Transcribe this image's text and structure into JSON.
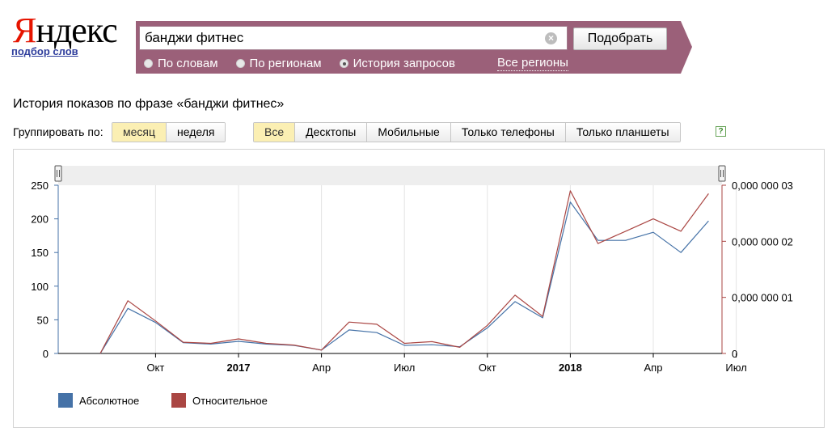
{
  "logo": {
    "first_letter": "Я",
    "rest": "ндекс",
    "sub_link": "подбор слов"
  },
  "search": {
    "value": "банджи фитнес",
    "submit_label": "Подобрать",
    "options": [
      {
        "label": "По словам",
        "checked": false
      },
      {
        "label": "По регионам",
        "checked": false
      },
      {
        "label": "История запросов",
        "checked": true
      }
    ],
    "regions_link": "Все регионы"
  },
  "heading": "История показов по фразе «банджи фитнес»",
  "grouping": {
    "label": "Группировать по:",
    "options": [
      "месяц",
      "неделя"
    ],
    "active": 0
  },
  "devices": {
    "options": [
      "Все",
      "Десктопы",
      "Мобильные",
      "Только телефоны",
      "Только планшеты"
    ],
    "active": 0,
    "help": "?"
  },
  "colors": {
    "absolute": "#4572a7",
    "relative": "#aa4643",
    "search_bg": "#9b6079"
  },
  "chart_data": {
    "type": "line",
    "x_labels": [
      "Окт",
      "2017",
      "Апр",
      "Июл",
      "Окт",
      "2018",
      "Апр",
      "Июл"
    ],
    "x_months": [
      "2016-08",
      "2016-09",
      "2016-10",
      "2016-11",
      "2016-12",
      "2017-01",
      "2017-02",
      "2017-03",
      "2017-04",
      "2017-05",
      "2017-06",
      "2017-07",
      "2017-08",
      "2017-09",
      "2017-10",
      "2017-11",
      "2017-12",
      "2018-01",
      "2018-02",
      "2018-03",
      "2018-04",
      "2018-05",
      "2018-06",
      "2018-07"
    ],
    "series": [
      {
        "name": "Абсолютное",
        "axis": "left",
        "values": [
          0,
          67,
          46,
          16,
          14,
          18,
          14,
          12,
          5,
          35,
          31,
          12,
          13,
          10,
          38,
          77,
          53,
          225,
          168,
          168,
          180,
          150,
          197
        ]
      },
      {
        "name": "Относительное",
        "axis": "right",
        "values": [
          0,
          9.4e-09,
          5.8e-09,
          2e-09,
          1.8e-09,
          2.6e-09,
          1.8e-09,
          1.5e-09,
          6e-10,
          5.6e-09,
          5.2e-09,
          1.8e-09,
          2.1e-09,
          1.1e-09,
          5e-09,
          1.04e-08,
          6.6e-09,
          2.9e-08,
          1.96e-08,
          2.18e-08,
          2.4e-08,
          2.18e-08,
          2.85e-08
        ]
      }
    ],
    "y_left_ticks": [
      "0",
      "50",
      "100",
      "150",
      "200",
      "250"
    ],
    "y_left_range": [
      0,
      250
    ],
    "y_right_ticks": [
      "0",
      "0,000 000 01",
      "0,000 000 02",
      "0,000 000 03"
    ],
    "y_right_range": [
      0,
      3e-08
    ],
    "grid": "vertical",
    "legend_position": "bottom-left"
  }
}
